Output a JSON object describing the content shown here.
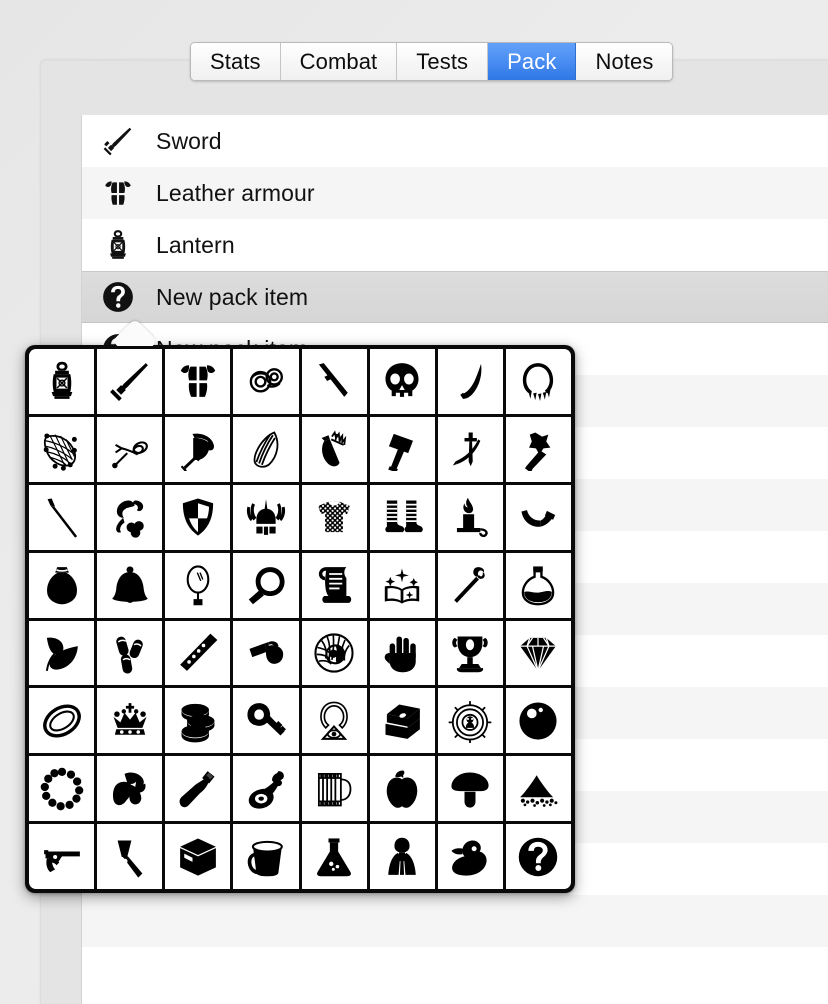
{
  "window": {
    "background_color": "#e9e9e9",
    "panel_color": "#e4e4e4"
  },
  "tabs": {
    "accent_color": "#4a8df2",
    "selected": "Pack",
    "items": [
      {
        "label": "Stats",
        "selected": false
      },
      {
        "label": "Combat",
        "selected": false
      },
      {
        "label": "Tests",
        "selected": false
      },
      {
        "label": "Pack",
        "selected": true
      },
      {
        "label": "Notes",
        "selected": false
      }
    ]
  },
  "pack_list": {
    "selected_index": 3,
    "rows": [
      {
        "label": "Sword",
        "icon": "sword-icon",
        "selected": false
      },
      {
        "label": "Leather armour",
        "icon": "armour-icon",
        "selected": false
      },
      {
        "label": "Lantern",
        "icon": "lantern-icon",
        "selected": false
      },
      {
        "label": "New pack item",
        "icon": "question-mark-icon",
        "selected": true
      },
      {
        "label": "New pack item",
        "icon": "question-mark-icon",
        "selected": false
      },
      {
        "label": "",
        "icon": "",
        "selected": false
      },
      {
        "label": "",
        "icon": "",
        "selected": false
      },
      {
        "label": "",
        "icon": "",
        "selected": false
      },
      {
        "label": "",
        "icon": "",
        "selected": false
      },
      {
        "label": "",
        "icon": "",
        "selected": false
      },
      {
        "label": "",
        "icon": "",
        "selected": false
      },
      {
        "label": "",
        "icon": "",
        "selected": false
      },
      {
        "label": "",
        "icon": "",
        "selected": false
      },
      {
        "label": "",
        "icon": "",
        "selected": false
      },
      {
        "label": "",
        "icon": "",
        "selected": false
      },
      {
        "label": "",
        "icon": "",
        "selected": false
      },
      {
        "label": "",
        "icon": "",
        "selected": false
      }
    ]
  },
  "icon_picker": {
    "columns": 8,
    "rows": 8,
    "border_color": "#0a0a0a",
    "cell_color": "#ffffff",
    "icons": [
      "lantern-icon",
      "sword-icon",
      "leather-armour-icon",
      "rope-coil-icon",
      "spear-icon",
      "skull-icon",
      "claw-fang-icon",
      "tooth-necklace-icon",
      "net-icon",
      "slingshot-icon",
      "battle-axe-icon",
      "feather-quill-icon",
      "quiver-arrows-icon",
      "war-hammer-icon",
      "crossed-blades-icon",
      "mace-icon",
      "dart-icon",
      "bolas-icon",
      "shield-icon",
      "horned-helmet-icon",
      "chainmail-shirt-icon",
      "boots-icon",
      "candle-icon",
      "drinking-horn-icon",
      "coin-pouch-icon",
      "bell-icon",
      "hand-mirror-icon",
      "magnifying-glass-icon",
      "scroll-icon",
      "spellbook-icon",
      "staff-icon",
      "potion-flask-icon",
      "herb-leaf-icon",
      "pills-icon",
      "flute-icon",
      "whistle-icon",
      "eyeball-icon",
      "hand-icon",
      "chalice-icon",
      "gemstone-icon",
      "ring-icon",
      "crown-icon",
      "coin-stack-icon",
      "key-icon",
      "eye-amulet-icon",
      "treasure-chest-icon",
      "compass-medallion-icon",
      "orb-icon",
      "prayer-beads-icon",
      "bread-icon",
      "bottle-icon",
      "ham-icon",
      "beer-mug-icon",
      "apple-icon",
      "mushroom-icon",
      "powder-pile-icon",
      "revolver-icon",
      "flashlight-icon",
      "crate-box-icon",
      "bucket-icon",
      "erlenmeyer-flask-icon",
      "cloaked-figure-icon",
      "rubber-duck-icon",
      "question-mark-icon"
    ]
  }
}
